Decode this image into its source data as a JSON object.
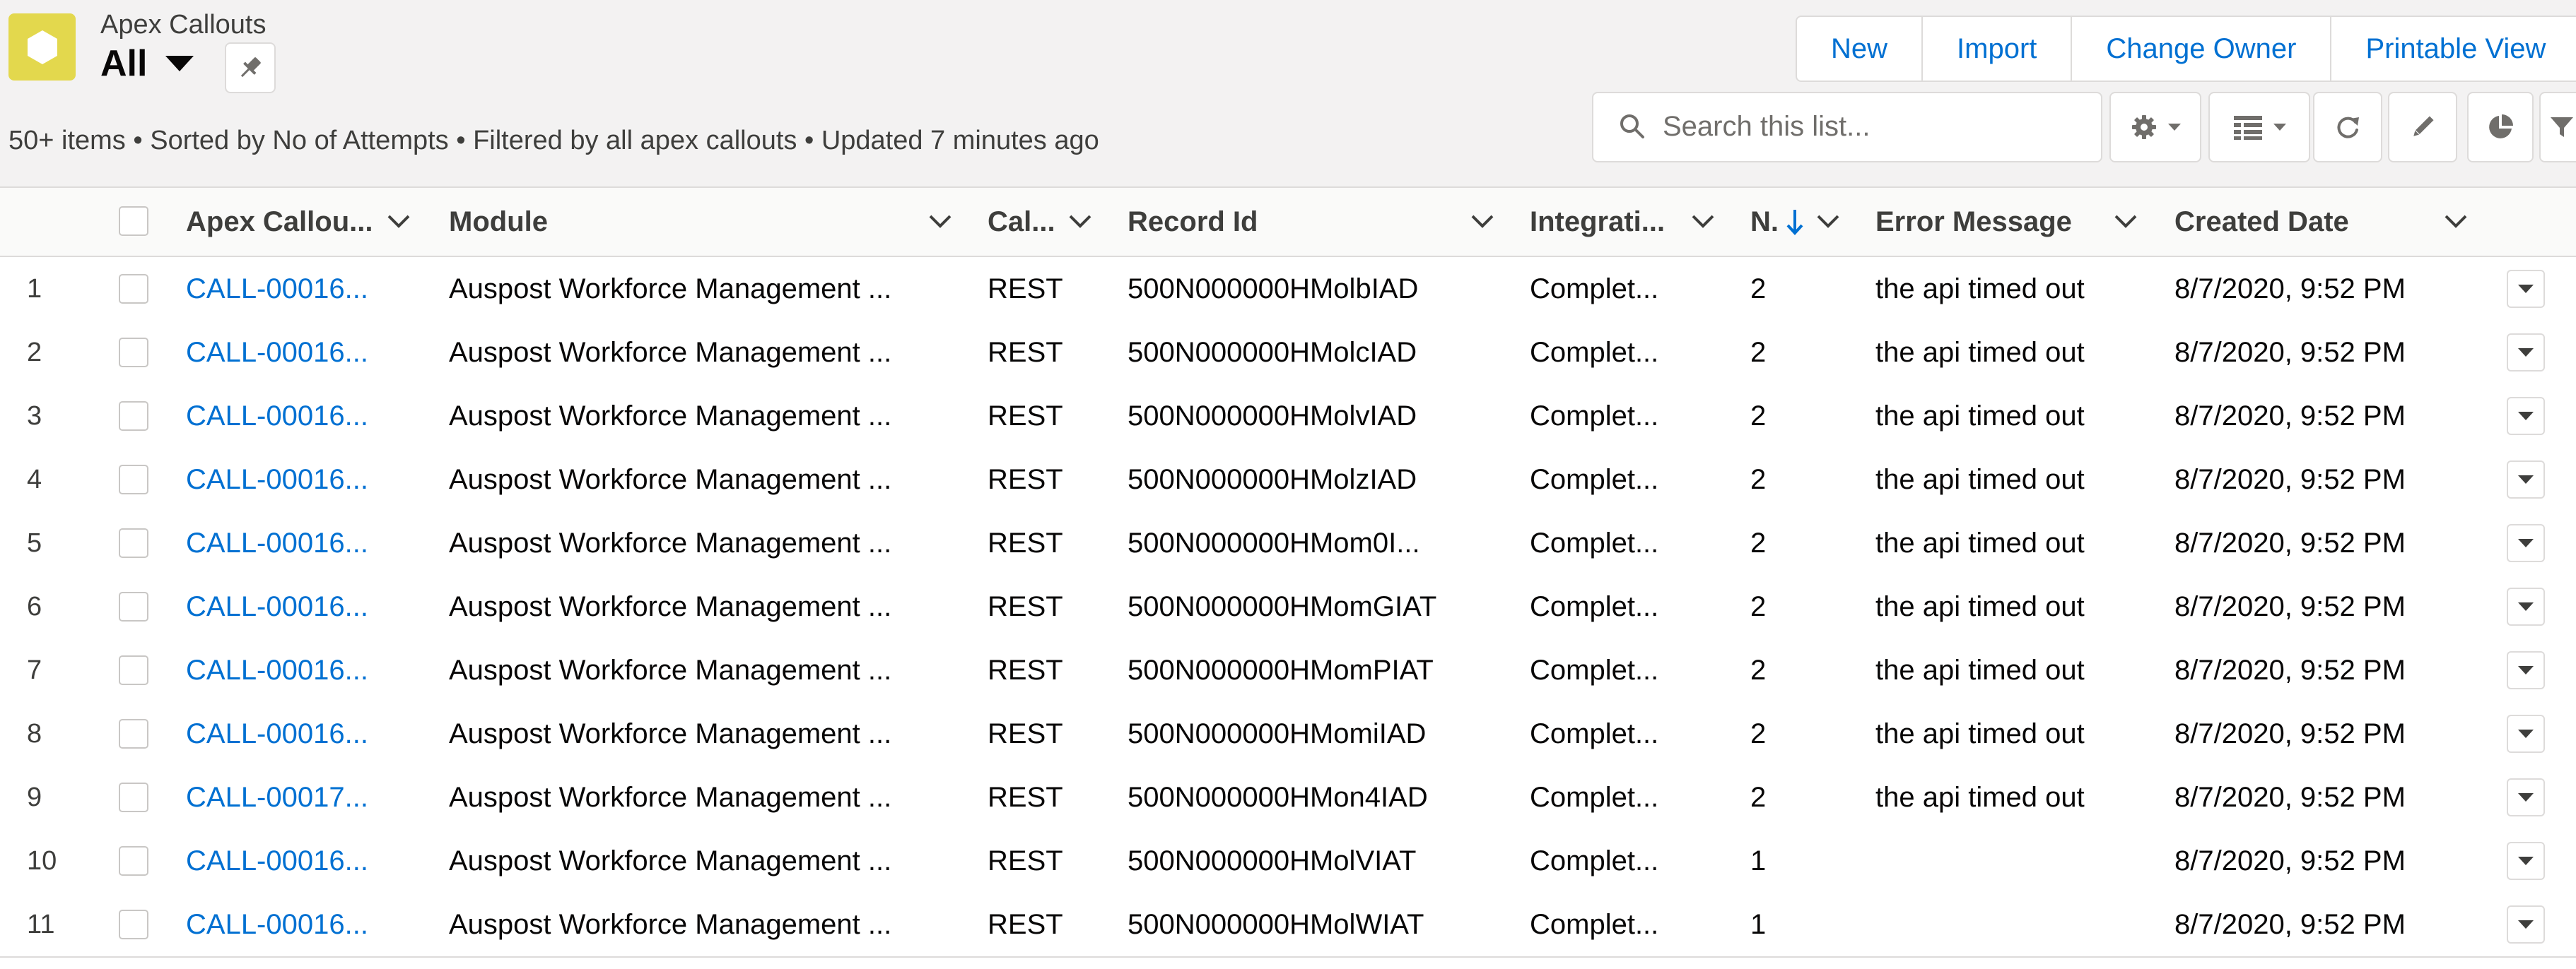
{
  "header": {
    "object_label": "Apex Callouts",
    "listview_name": "All",
    "meta": "50+ items • Sorted by No of Attempts • Filtered by all apex callouts • Updated 7 minutes ago"
  },
  "actions": {
    "new": "New",
    "import": "Import",
    "change_owner": "Change Owner",
    "printable_view": "Printable View"
  },
  "search": {
    "placeholder": "Search this list..."
  },
  "toolbar_icons": [
    "gear-icon",
    "table-icon",
    "refresh-icon",
    "pencil-icon",
    "pie-chart-icon",
    "filter-icon"
  ],
  "colors": {
    "accent": "#0070d2",
    "app_icon": "#e3d84d",
    "header_bg": "#f3f2f2"
  },
  "columns": {
    "name": "Apex Callou...",
    "module": "Module",
    "callout_type": "Cal...",
    "record_id": "Record Id",
    "integration_status": "Integrati...",
    "no_of_attempts": "N.",
    "error_message": "Error Message",
    "created_date": "Created Date"
  },
  "rows": [
    {
      "num": "1",
      "name": "CALL-00016...",
      "module": "Auspost Workforce Management ...",
      "type": "REST",
      "record_id": "500N000000HMolbIAD",
      "status": "Complet...",
      "attempts": "2",
      "error": "the api timed out",
      "created": "8/7/2020, 9:52 PM"
    },
    {
      "num": "2",
      "name": "CALL-00016...",
      "module": "Auspost Workforce Management ...",
      "type": "REST",
      "record_id": "500N000000HMolcIAD",
      "status": "Complet...",
      "attempts": "2",
      "error": "the api timed out",
      "created": "8/7/2020, 9:52 PM"
    },
    {
      "num": "3",
      "name": "CALL-00016...",
      "module": "Auspost Workforce Management ...",
      "type": "REST",
      "record_id": "500N000000HMolvIAD",
      "status": "Complet...",
      "attempts": "2",
      "error": "the api timed out",
      "created": "8/7/2020, 9:52 PM"
    },
    {
      "num": "4",
      "name": "CALL-00016...",
      "module": "Auspost Workforce Management ...",
      "type": "REST",
      "record_id": "500N000000HMolzIAD",
      "status": "Complet...",
      "attempts": "2",
      "error": "the api timed out",
      "created": "8/7/2020, 9:52 PM"
    },
    {
      "num": "5",
      "name": "CALL-00016...",
      "module": "Auspost Workforce Management ...",
      "type": "REST",
      "record_id": "500N000000HMom0I...",
      "status": "Complet...",
      "attempts": "2",
      "error": "the api timed out",
      "created": "8/7/2020, 9:52 PM"
    },
    {
      "num": "6",
      "name": "CALL-00016...",
      "module": "Auspost Workforce Management ...",
      "type": "REST",
      "record_id": "500N000000HMomGIAT",
      "status": "Complet...",
      "attempts": "2",
      "error": "the api timed out",
      "created": "8/7/2020, 9:52 PM"
    },
    {
      "num": "7",
      "name": "CALL-00016...",
      "module": "Auspost Workforce Management ...",
      "type": "REST",
      "record_id": "500N000000HMomPIAT",
      "status": "Complet...",
      "attempts": "2",
      "error": "the api timed out",
      "created": "8/7/2020, 9:52 PM"
    },
    {
      "num": "8",
      "name": "CALL-00016...",
      "module": "Auspost Workforce Management ...",
      "type": "REST",
      "record_id": "500N000000HMomiIAD",
      "status": "Complet...",
      "attempts": "2",
      "error": "the api timed out",
      "created": "8/7/2020, 9:52 PM"
    },
    {
      "num": "9",
      "name": "CALL-00017...",
      "module": "Auspost Workforce Management ...",
      "type": "REST",
      "record_id": "500N000000HMon4IAD",
      "status": "Complet...",
      "attempts": "2",
      "error": "the api timed out",
      "created": "8/7/2020, 9:52 PM"
    },
    {
      "num": "10",
      "name": "CALL-00016...",
      "module": "Auspost Workforce Management ...",
      "type": "REST",
      "record_id": "500N000000HMolVIAT",
      "status": "Complet...",
      "attempts": "1",
      "error": "",
      "created": "8/7/2020, 9:52 PM"
    },
    {
      "num": "11",
      "name": "CALL-00016...",
      "module": "Auspost Workforce Management ...",
      "type": "REST",
      "record_id": "500N000000HMolWIAT",
      "status": "Complet...",
      "attempts": "1",
      "error": "",
      "created": "8/7/2020, 9:52 PM"
    }
  ]
}
